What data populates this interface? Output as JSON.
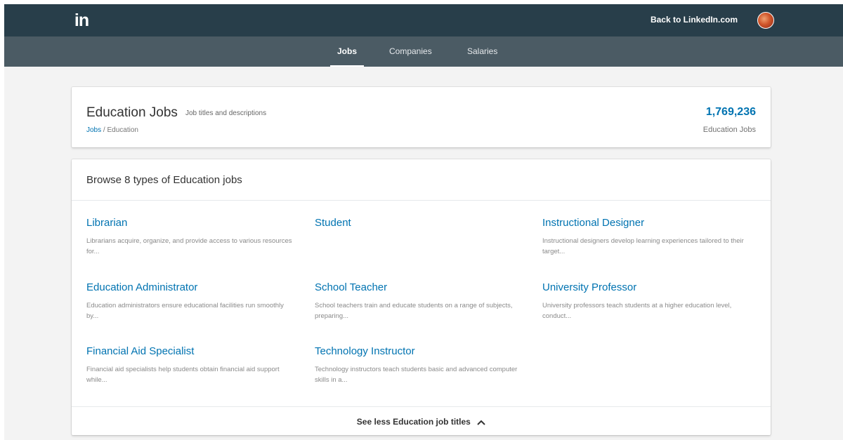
{
  "topbar": {
    "logo_text": "in",
    "back_link": "Back to LinkedIn.com"
  },
  "subnav": {
    "tabs": [
      {
        "label": "Jobs",
        "active": true
      },
      {
        "label": "Companies",
        "active": false
      },
      {
        "label": "Salaries",
        "active": false
      }
    ]
  },
  "header": {
    "title": "Education Jobs",
    "subtitle": "Job titles and descriptions",
    "breadcrumb_link": "Jobs",
    "breadcrumb_sep": " / ",
    "breadcrumb_current": "Education",
    "count": "1,769,236",
    "count_label": "Education Jobs"
  },
  "browse": {
    "title": "Browse 8 types of Education jobs",
    "jobs": [
      {
        "title": "Librarian",
        "desc": "Librarians acquire, organize, and provide access to various resources for..."
      },
      {
        "title": "Student",
        "desc": ""
      },
      {
        "title": "Instructional Designer",
        "desc": "Instructional designers develop learning experiences tailored to their target..."
      },
      {
        "title": "Education Administrator",
        "desc": "Education administrators ensure educational facilities run smoothly by..."
      },
      {
        "title": "School Teacher",
        "desc": "School teachers train and educate students on a range of subjects, preparing..."
      },
      {
        "title": "University Professor",
        "desc": "University professors teach students at a higher education level, conduct..."
      },
      {
        "title": "Financial Aid Specialist",
        "desc": "Financial aid specialists help students obtain financial aid support while..."
      },
      {
        "title": "Technology Instructor",
        "desc": "Technology instructors teach students basic and advanced computer skills in a..."
      }
    ],
    "see_less": "See less Education job titles"
  },
  "colors": {
    "topbar": "#283e4a",
    "subnav": "#4b5b64",
    "link": "#0073b1",
    "background": "#f3f3f3"
  },
  "icons": {
    "logo": "linkedin-logo-icon",
    "avatar": "user-avatar-icon",
    "see_less": "chevron-up-icon"
  }
}
